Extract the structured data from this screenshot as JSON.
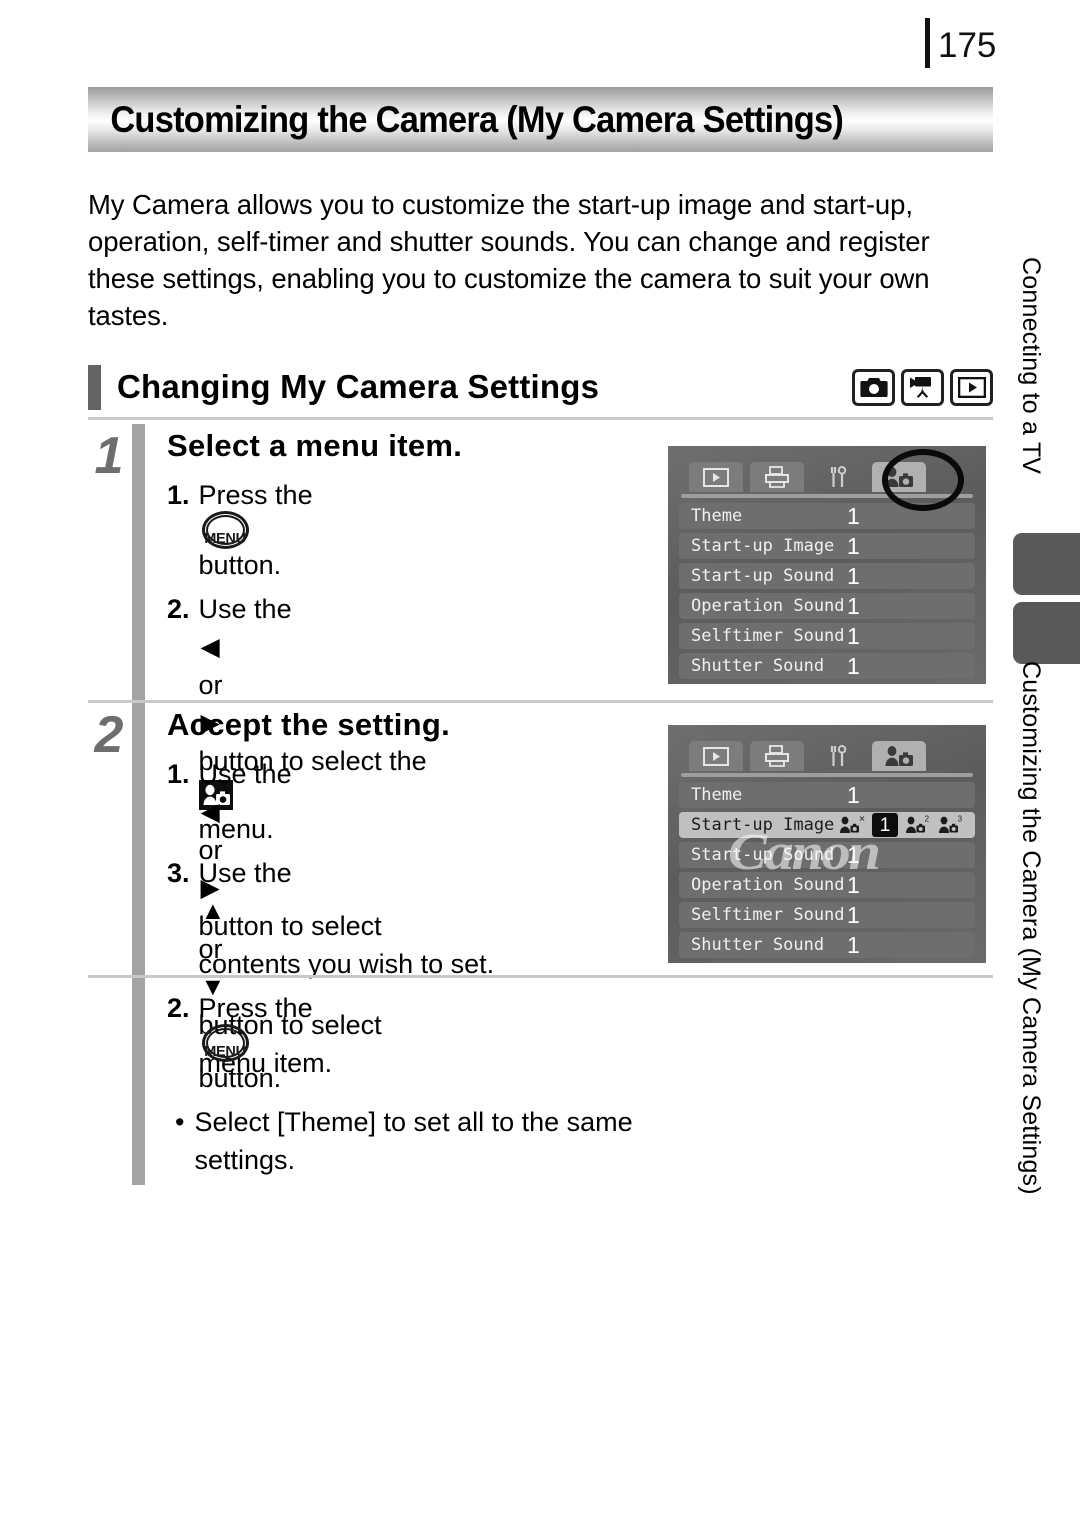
{
  "page": {
    "number": "175"
  },
  "banner": {
    "title": "Customizing the Camera (My Camera Settings)"
  },
  "intro": {
    "line1": "My Camera allows you to customize the start-up image and start-up,",
    "line2": "operation, self-timer and shutter sounds. You can change and register",
    "line3": "these settings, enabling you to customize the camera to suit your own",
    "line4": "tastes."
  },
  "section": {
    "title": "Changing My Camera Settings",
    "mode_icons": [
      "still-camera-icon",
      "movie-camera-icon",
      "playback-icon"
    ]
  },
  "steps": [
    {
      "number": "1",
      "title": "Select a menu item.",
      "items": [
        {
          "marker": "1.",
          "pre": "Press the",
          "button": "MENU",
          "post": "button."
        },
        {
          "marker": "2.",
          "pre": "Use the",
          "arrow1": "◀",
          "mid": "or",
          "arrow2": "▶",
          "post": "button to select the",
          "post2": "menu.",
          "icon": "my-camera-menu-icon"
        },
        {
          "marker": "3.",
          "pre": "Use the",
          "arrow1": "▲",
          "mid": "or",
          "arrow2": "▼",
          "post": "button to select",
          "post2": "menu item."
        }
      ]
    },
    {
      "number": "2",
      "title": "Accept the setting.",
      "items": [
        {
          "marker": "1.",
          "pre": "Use the",
          "arrow1": "◀",
          "mid": "or",
          "arrow2": "▶",
          "post": "button to select",
          "post2": "contents you wish to set."
        },
        {
          "marker": "2.",
          "pre": "Press the",
          "button": "MENU",
          "post": "button."
        },
        {
          "marker": "•",
          "post": "Select [Theme] to set all to the same",
          "post2": "settings."
        }
      ]
    }
  ],
  "lcd1": {
    "tabs": [
      {
        "name": "playback-tab",
        "active": false
      },
      {
        "name": "print-tab",
        "active": false
      },
      {
        "name": "setup-tab",
        "active": false
      },
      {
        "name": "my-camera-tab",
        "active": true
      }
    ],
    "rows": [
      {
        "label": "Theme",
        "value": "1"
      },
      {
        "label": "Start-up Image",
        "value": "1"
      },
      {
        "label": "Start-up Sound",
        "value": "1"
      },
      {
        "label": "Operation Sound",
        "value": "1"
      },
      {
        "label": "Selftimer Sound",
        "value": "1"
      },
      {
        "label": "Shutter Sound",
        "value": "1"
      }
    ]
  },
  "lcd2": {
    "watermark": "Canon",
    "tabs": [
      {
        "name": "playback-tab",
        "active": false
      },
      {
        "name": "print-tab",
        "active": false
      },
      {
        "name": "setup-tab",
        "active": false
      },
      {
        "name": "my-camera-tab",
        "active": true
      }
    ],
    "rows": [
      {
        "label": "Theme",
        "value": "1",
        "highlighted": false
      },
      {
        "label": "Start-up Image",
        "value": "1",
        "highlighted": true,
        "options": [
          "✕",
          "1",
          "2",
          "3"
        ],
        "selected_index": 1
      },
      {
        "label": "Start-up Sound",
        "value": "1",
        "highlighted": false
      },
      {
        "label": "Operation Sound",
        "value": "1",
        "highlighted": false
      },
      {
        "label": "Selftimer Sound",
        "value": "1",
        "highlighted": false
      },
      {
        "label": "Shutter Sound",
        "value": "1",
        "highlighted": false
      }
    ]
  },
  "sidebar": {
    "top_label": "Connecting to a TV",
    "bottom_label": "Customizing the Camera (My Camera Settings)"
  }
}
